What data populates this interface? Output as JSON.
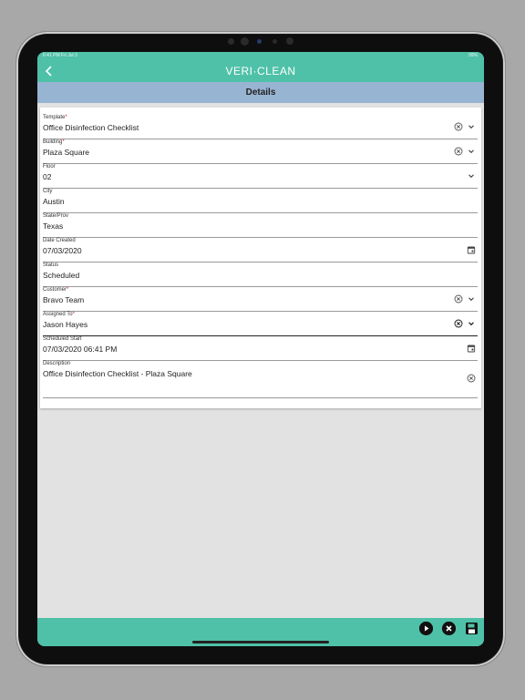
{
  "status_bar": {
    "time": "6:41 PM  Fri Jul 3",
    "battery": "99%"
  },
  "app": {
    "brand": "VERI·CLEAN",
    "page_title": "Details"
  },
  "fields": [
    {
      "label": "Template",
      "required": true,
      "value": "Office Disinfection Checklist",
      "icons": [
        "clear-icon",
        "chevron-down-icon"
      ]
    },
    {
      "label": "Building",
      "required": true,
      "value": "Plaza Square",
      "icons": [
        "clear-icon",
        "chevron-down-icon"
      ]
    },
    {
      "label": "Floor",
      "required": false,
      "value": "02",
      "icons": [
        "chevron-down-icon"
      ]
    },
    {
      "label": "City",
      "required": false,
      "value": "Austin",
      "icons": []
    },
    {
      "label": "State/Prov",
      "required": false,
      "value": "Texas",
      "icons": []
    },
    {
      "label": "Date Created",
      "required": false,
      "value": "07/03/2020",
      "icons": [
        "calendar-icon"
      ]
    },
    {
      "label": "Status",
      "required": false,
      "value": "Scheduled",
      "icons": []
    },
    {
      "label": "Customer",
      "required": true,
      "value": "Bravo Team",
      "icons": [
        "clear-icon",
        "chevron-down-icon"
      ]
    },
    {
      "label": "Assigned To",
      "required": true,
      "value": "Jason Hayes",
      "icons": [
        "clear-icon",
        "chevron-down-icon"
      ]
    },
    {
      "label": "Scheduled Start",
      "required": false,
      "value": "07/03/2020 06:41 PM",
      "icons": [
        "calendar-icon"
      ]
    },
    {
      "label": "Description",
      "required": false,
      "value": "Office Disinfection Checklist - Plaza Square",
      "icons": [
        "clear-icon"
      ]
    }
  ],
  "toolbar": {
    "buttons": [
      "play-icon",
      "cancel-icon",
      "save-icon"
    ]
  }
}
